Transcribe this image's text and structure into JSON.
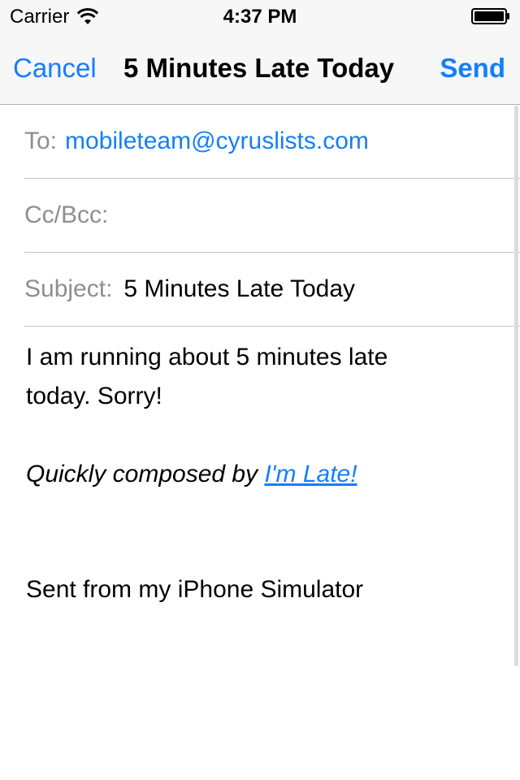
{
  "status_bar": {
    "carrier": "Carrier",
    "time": "4:37 PM",
    "wifi_icon": "wifi-icon",
    "battery_icon": "battery-icon"
  },
  "nav_bar": {
    "cancel_label": "Cancel",
    "title": "5 Minutes Late Today",
    "send_label": "Send"
  },
  "fields": {
    "to_label": "To:",
    "to_value": "mobileteam@cyruslists.com",
    "ccbcc_label": "Cc/Bcc:",
    "subject_label": "Subject:",
    "subject_value": "5 Minutes Late Today"
  },
  "body": {
    "line1": "I am running about 5 minutes late",
    "line2": "today. Sorry!",
    "signature_prefix": "Quickly composed by ",
    "signature_link": "I'm Late!",
    "sent_from": "Sent from my iPhone Simulator"
  },
  "colors": {
    "accent": "#157efb",
    "label_gray": "#8e8e93",
    "separator": "#c8c7cc",
    "bar_bg": "#f7f7f8"
  }
}
